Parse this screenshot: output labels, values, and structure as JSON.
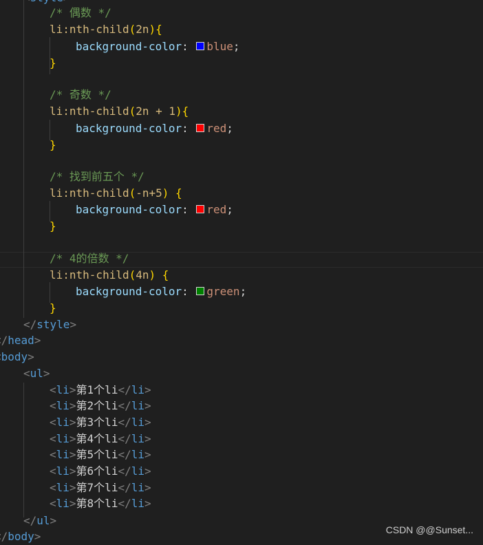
{
  "editor": {
    "style_open_tag": "style",
    "comment_even": "/* 偶数 */",
    "sel_even_prefix": "li:nth-child",
    "sel_even_arg": "2n",
    "comment_odd": "/* 奇数 */",
    "sel_odd_arg": "2n + 1",
    "comment_first5": "/* 找到前五个 */",
    "sel_first5_arg": "-n+5",
    "comment_4x": "/* 4的倍数 */",
    "sel_4x_arg": "4n",
    "prop": "background-color",
    "val_blue": "blue",
    "val_red": "red",
    "val_green": "green",
    "color_blue": "#0000ff",
    "color_red": "#ff0000",
    "color_green": "#008000",
    "style_close": "style",
    "head_close": "head",
    "body_open": "body",
    "ul_open": "ul",
    "li_tag": "li",
    "li_items": [
      "第1个li",
      "第2个li",
      "第3个li",
      "第4个li",
      "第5个li",
      "第6个li",
      "第7个li",
      "第8个li"
    ],
    "ul_close": "ul",
    "body_close": "body"
  },
  "watermark": "CSDN @@Sunset..."
}
